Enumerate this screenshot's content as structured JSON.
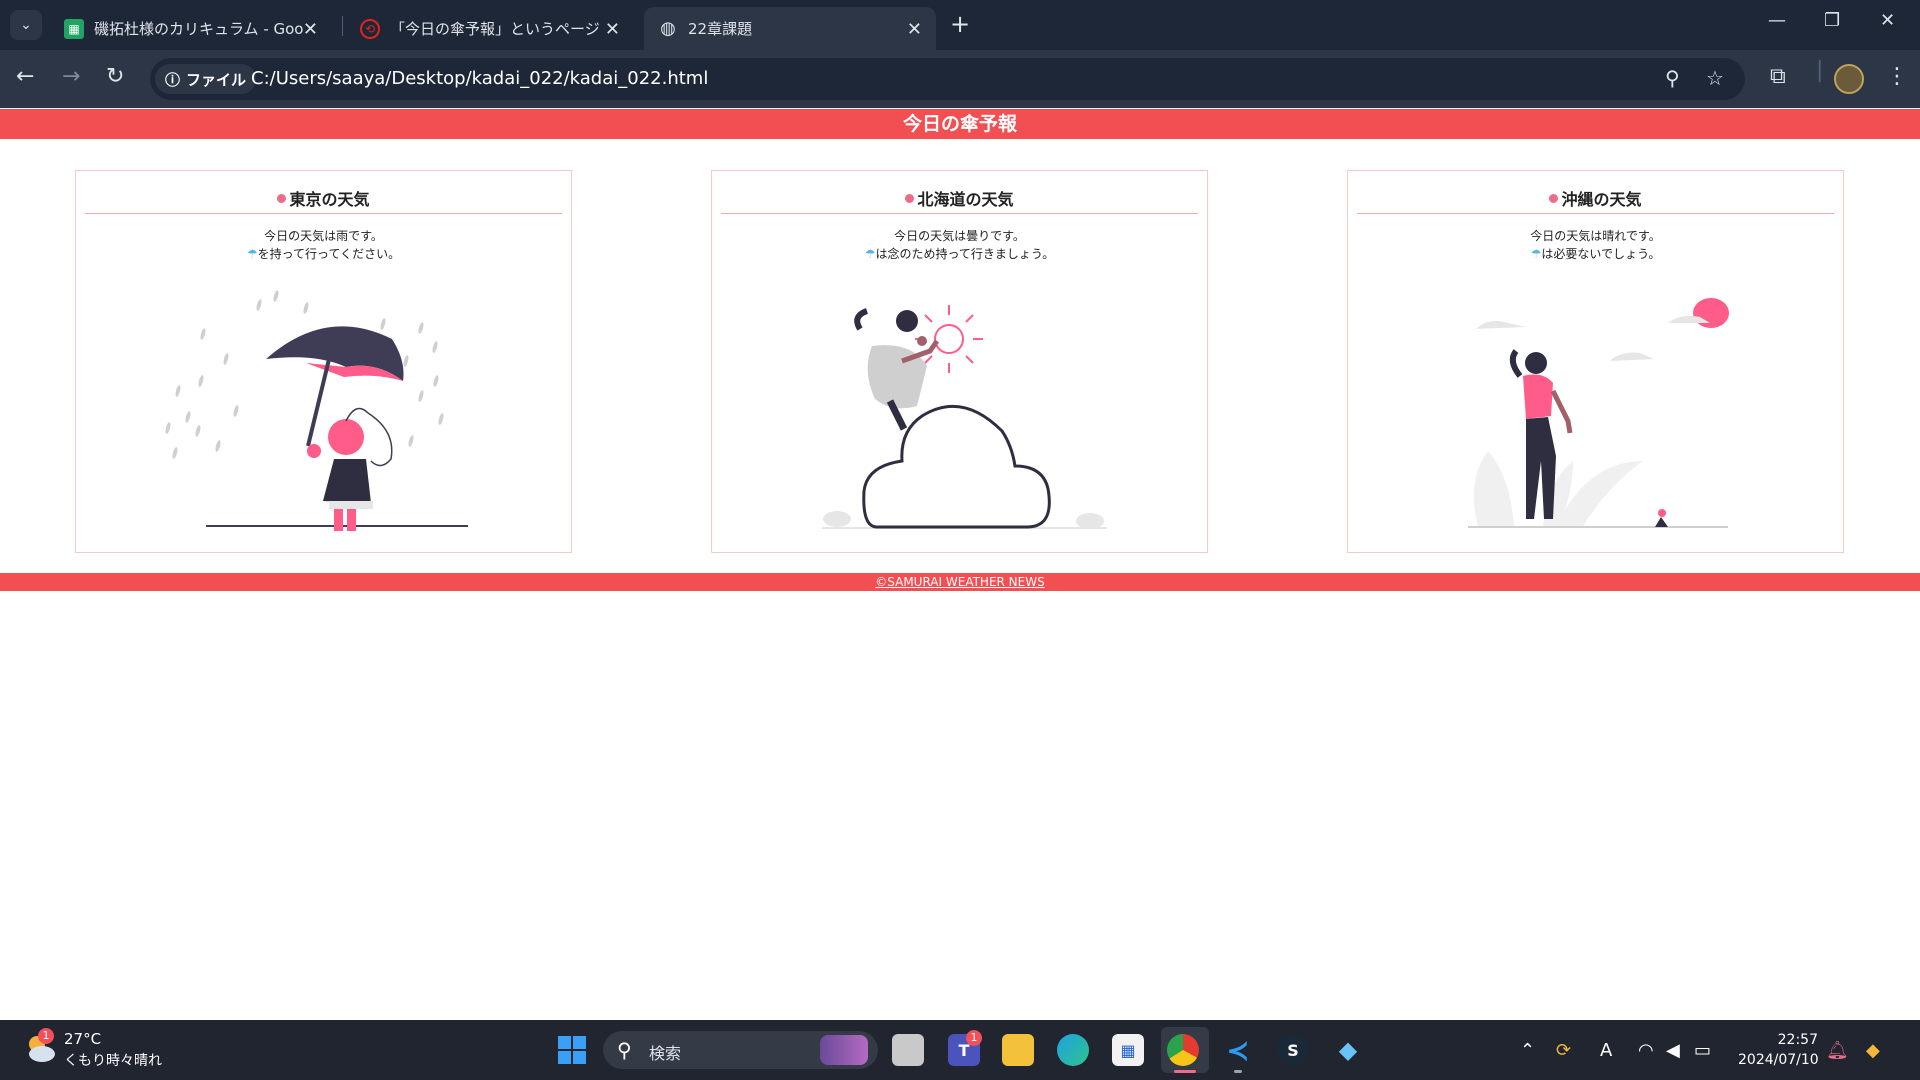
{
  "browser": {
    "tabs": [
      {
        "title": "磯拓杜様のカリキュラム - Google スプレッドシート",
        "favicon": "sheets-icon"
      },
      {
        "title": "「今日の傘予報」というページを作成",
        "favicon": "samurai-icon"
      },
      {
        "title": "22章課題",
        "favicon": "globe-icon"
      }
    ],
    "chip_label": "ファイル",
    "url": "C:/Users/saaya/Desktop/kadai_022/kadai_022.html"
  },
  "page": {
    "header_title": "今日の傘予報",
    "cards": [
      {
        "title": "東京の天気",
        "line1": "今日の天気は雨です。",
        "umbrella": "☂",
        "line2": "を持って行ってください。",
        "illustration": "rain-umbrella"
      },
      {
        "title": "北海道の天気",
        "line1": "今日の天気は曇りです。",
        "umbrella": "☂",
        "line2": "は念のため持って行きましょう。",
        "illustration": "cloud-sun"
      },
      {
        "title": "沖縄の天気",
        "line1": "今日の天気は晴れです。",
        "umbrella": "☂",
        "line2": "は必要ないでしょう。",
        "illustration": "sunny-walk"
      }
    ],
    "footer_text": "©SAMURAI WEATHER NEWS",
    "colors": {
      "accent": "#f24f53",
      "pink": "#ff5c8a",
      "dark": "#2f2e41",
      "umbrella_mark": "#51b6e8"
    }
  },
  "taskbar": {
    "weather_temp": "27°C",
    "weather_condition": "くもり時々晴れ",
    "weather_badge": "1",
    "search_label": "検索",
    "teams_badge": "1",
    "time": "22:57",
    "date": "2024/07/10"
  }
}
